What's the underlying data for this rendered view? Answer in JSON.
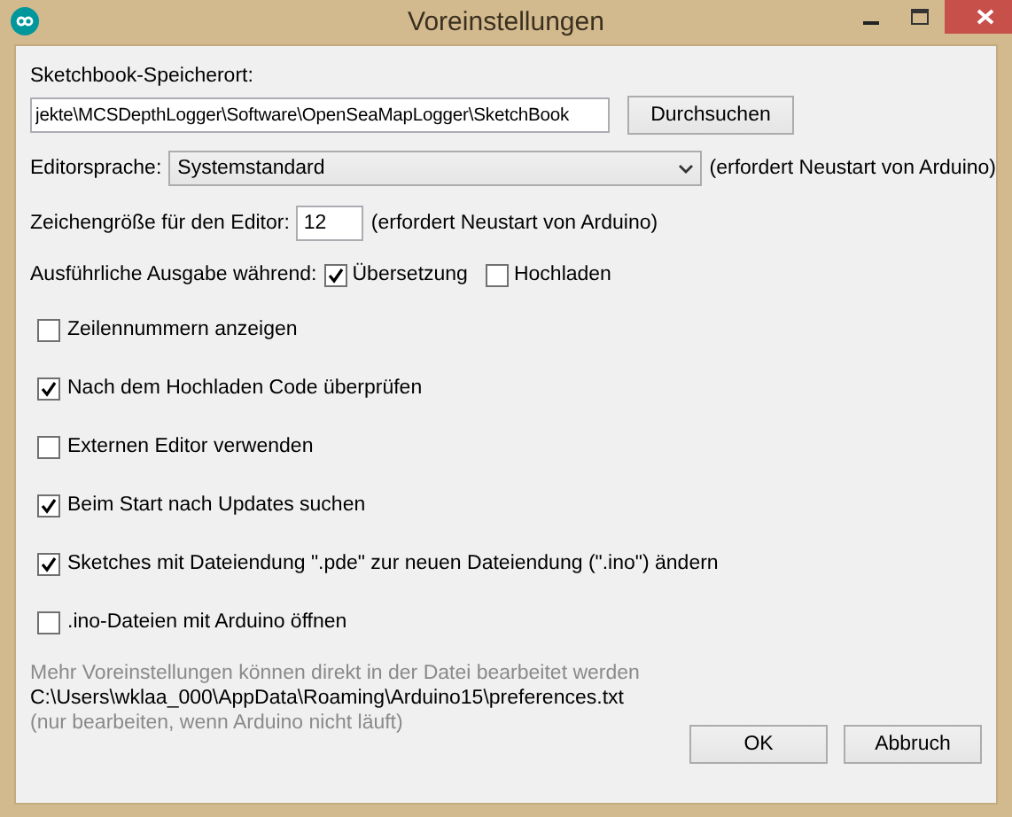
{
  "window": {
    "title": "Voreinstellungen"
  },
  "sketchbook": {
    "label": "Sketchbook-Speicherort:",
    "value": "jekte\\MCSDepthLogger\\Software\\OpenSeaMapLogger\\SketchBook",
    "browse_button": "Durchsuchen"
  },
  "language": {
    "label": "Editorsprache:",
    "value": "Systemstandard",
    "note": "(erfordert Neustart von Arduino)"
  },
  "font_size": {
    "label": "Zeichengröße für den Editor:",
    "value": "12",
    "note": "(erfordert Neustart von Arduino)"
  },
  "verbose": {
    "label": "Ausführliche Ausgabe während:",
    "options": [
      {
        "label": "Übersetzung",
        "checked": true
      },
      {
        "label": "Hochladen",
        "checked": false
      }
    ]
  },
  "options": [
    {
      "label": "Zeilennummern anzeigen",
      "checked": false
    },
    {
      "label": "Nach dem Hochladen Code überprüfen",
      "checked": true
    },
    {
      "label": "Externen Editor verwenden",
      "checked": false
    },
    {
      "label": "Beim Start nach Updates suchen",
      "checked": true
    },
    {
      "label": "Sketches mit Dateiendung \".pde\" zur neuen Dateiendung (\".ino\") ändern",
      "checked": true
    },
    {
      "label": ".ino-Dateien mit Arduino öffnen",
      "checked": false
    }
  ],
  "footer": {
    "hint": "Mehr Voreinstellungen können direkt in der Datei bearbeitet werden",
    "path": "C:\\Users\\wklaa_000\\AppData\\Roaming\\Arduino15\\preferences.txt",
    "note": "(nur bearbeiten, wenn Arduino nicht läuft)"
  },
  "buttons": [
    "OK",
    "Abbruch"
  ]
}
